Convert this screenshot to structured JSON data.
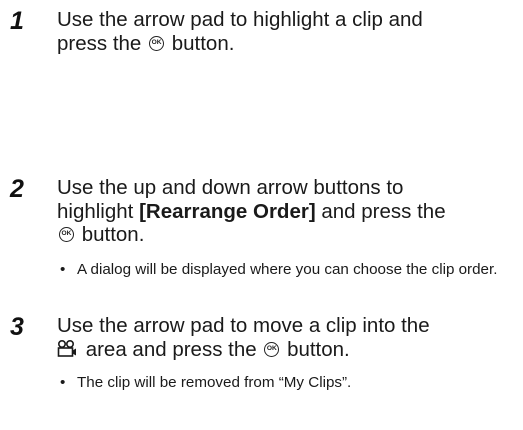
{
  "steps": [
    {
      "number": "1",
      "text_a": "Use the arrow pad to highlight a clip and",
      "text_b": "press the",
      "text_c": "button."
    },
    {
      "number": "2",
      "text_a": "Use the up and down arrow buttons to",
      "text_b": "highlight",
      "text_bold": "[Rearrange Order]",
      "text_c": "and press the",
      "text_d": "button.",
      "bullet": "A dialog will be displayed where you can choose the clip order."
    },
    {
      "number": "3",
      "text_a": "Use the arrow pad to move a clip into the",
      "text_b": "area and press the",
      "text_c": "button.",
      "bullet": "The clip will be removed from “My Clips”."
    }
  ],
  "bullet_char": "•",
  "icons": {
    "ok_button": "ok-button-icon",
    "clip_area": "clip-area-icon"
  }
}
